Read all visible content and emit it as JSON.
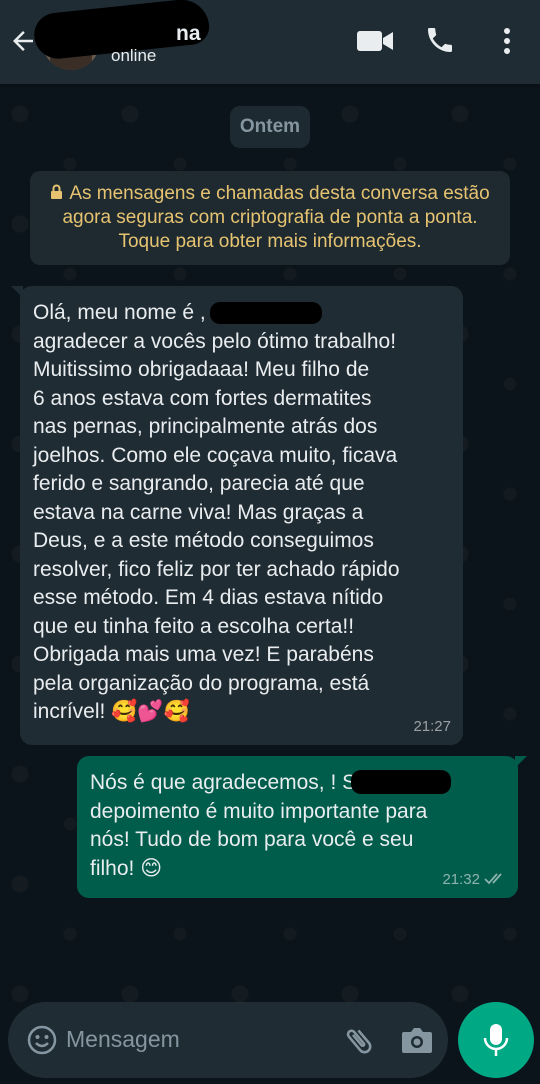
{
  "header": {
    "contact_name_visible": "na",
    "status": "online",
    "icons": [
      "back-arrow-icon",
      "video-call-icon",
      "phone-icon",
      "more-options-icon"
    ]
  },
  "chat": {
    "date_chip": "Ontem",
    "encryption_notice": "As mensagens e chamadas desta conversa estão agora seguras com criptografia de ponta a ponta. Toque para obter mais informações.",
    "messages": [
      {
        "direction": "incoming",
        "text": "Olá, meu nome é                , e quero\nagradecer a vocês pelo ótimo trabalho!\nMuitissimo obrigadaaa! Meu filho de\n6 anos estava com fortes dermatites\nnas pernas, principalmente atrás dos\njoelhos. Como ele coçava muito, ficava\nferido e sangrando, parecia até que\nestava na carne viva! Mas graças a\nDeus, e a este método conseguimos\nresolver, fico feliz por ter achado rápido\nesse método. Em 4 dias estava nítido\nque eu tinha feito a escolha certa!!\nObrigada mais uma vez! E parabéns\npela organização do programa, está\nincrível! 🥰💕🥰",
        "time": "21:27"
      },
      {
        "direction": "outgoing",
        "text": "Nós é que agradecemos,                ! Seu\ndepoimento é muito importante para\nnós! Tudo de bom para você e seu\nfilho! 😊",
        "time": "21:32"
      }
    ]
  },
  "composer": {
    "placeholder": "Mensagem",
    "icons": [
      "emoji-icon",
      "attach-icon",
      "camera-icon",
      "mic-icon"
    ]
  },
  "colors": {
    "header_bg": "#1f2c34",
    "wallpaper": "#0b141a",
    "incoming_bubble": "#202c33",
    "outgoing_bubble": "#005c4b",
    "encryption_text": "#e6c371",
    "accent": "#00a884"
  }
}
